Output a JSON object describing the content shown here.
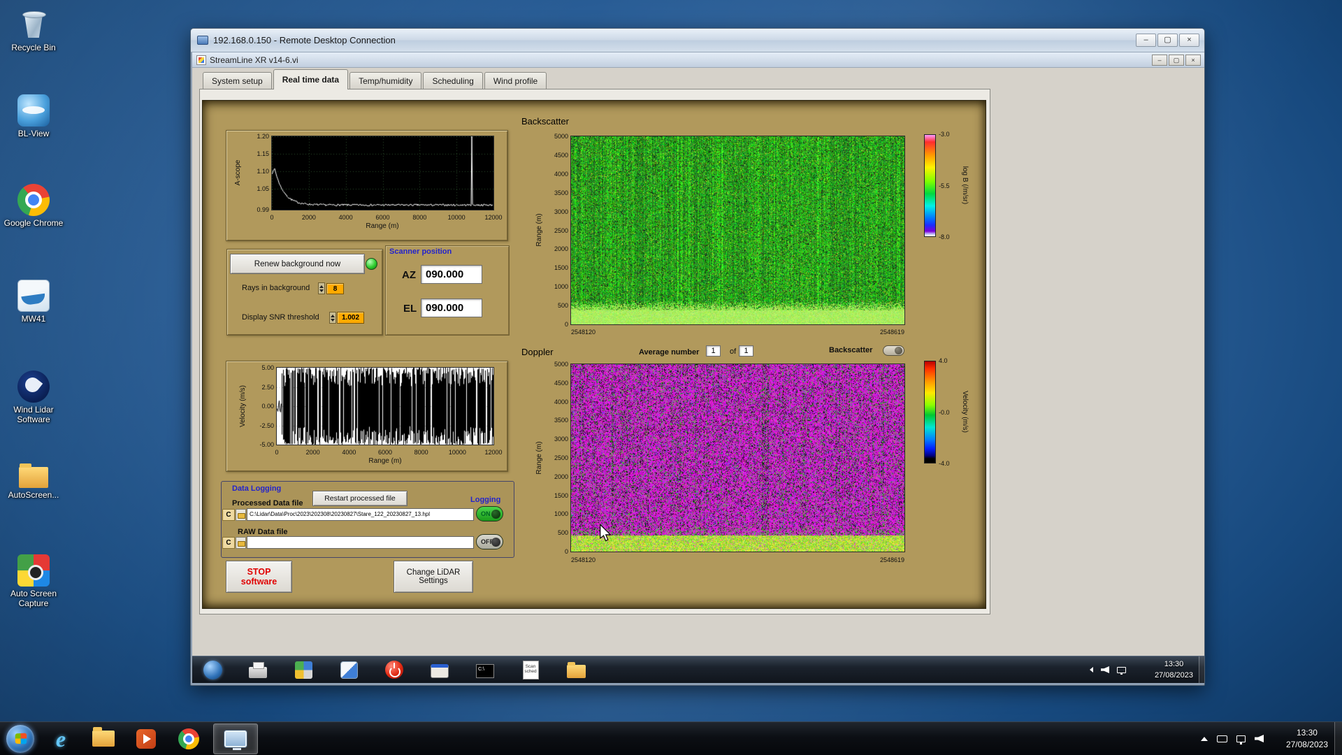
{
  "rdp": {
    "title": "192.168.0.150 - Remote Desktop Connection",
    "buttons": [
      {
        "name": "rdp-minimize-button",
        "glyph": "–"
      },
      {
        "name": "rdp-maximize-button",
        "glyph": "▢"
      },
      {
        "name": "rdp-close-button",
        "glyph": "×"
      }
    ]
  },
  "app": {
    "title": "StreamLine XR v14-6.vi",
    "buttons": [
      {
        "name": "app-minimize-button",
        "glyph": "–"
      },
      {
        "name": "app-restore-button",
        "glyph": "▢"
      },
      {
        "name": "app-close-button",
        "glyph": "×"
      }
    ],
    "tabs": [
      {
        "label": "System setup",
        "active": false
      },
      {
        "label": "Real time data",
        "active": true
      },
      {
        "label": "Temp/humidity",
        "active": false
      },
      {
        "label": "Scheduling",
        "active": false
      },
      {
        "label": "Wind profile",
        "active": false
      }
    ]
  },
  "panel": {
    "backscatter_title": "Backscatter",
    "doppler_title": "Doppler",
    "renew_button": "Renew background now",
    "rays_label": "Rays in background",
    "rays_value": "8",
    "snr_label": "Display SNR threshold",
    "snr_value": "1.002",
    "scanner": {
      "title": "Scanner position",
      "az_label": "AZ",
      "az_value": "090.000",
      "el_label": "EL",
      "el_value": "090.000"
    },
    "average": {
      "label": "Average number",
      "value": "1",
      "of_label": "of",
      "total": "1"
    },
    "backscatter_toggle_label": "Backscatter",
    "logging": {
      "title": "Data Logging",
      "processed_label": "Processed Data file",
      "restart_button": "Restart processed file",
      "logging_label": "Logging",
      "drive_label": "C",
      "processed_path": "C:\\Lidar\\Data\\Proc\\2023\\202308\\20230827\\Stare_122_20230827_13.hpl",
      "raw_label": "RAW Data file",
      "raw_path": "",
      "on_label": "ON",
      "off_label": "OFF"
    },
    "stop_button_line1": "STOP",
    "stop_button_line2": "software",
    "change_button_line1": "Change LiDAR",
    "change_button_line2": "Settings"
  },
  "chart_data": [
    {
      "id": "a_scope",
      "type": "line",
      "ylabel": "A-scope",
      "xlabel": "Range (m)",
      "xlim": [
        0,
        12000
      ],
      "ylim": [
        0.99,
        1.2
      ],
      "x_ticks": [
        0,
        2000,
        4000,
        6000,
        8000,
        10000,
        12000
      ],
      "y_ticks": [
        1.2,
        1.15,
        1.1,
        1.05,
        0.99
      ],
      "y_tick_labels": [
        "1.20",
        "1.15",
        "1.10",
        "1.05",
        "0.99"
      ],
      "grid": true,
      "line_color": "#ffffff",
      "background": "#000000",
      "series": [
        {
          "name": "a-scope trace",
          "x": [
            0,
            60,
            150,
            300,
            500,
            800,
            1200,
            1600,
            2000,
            3000,
            4000,
            5000,
            6000,
            7000,
            8000,
            9000,
            10000,
            10750,
            10820,
            10890,
            11500,
            12000
          ],
          "y": [
            1.093,
            1.102,
            1.108,
            1.062,
            1.035,
            1.018,
            1.009,
            1.006,
            1.005,
            1.004,
            1.004,
            1.003,
            1.004,
            1.003,
            1.004,
            1.003,
            1.004,
            1.004,
            1.2,
            1.004,
            1.003,
            1.003
          ]
        }
      ],
      "annotations": [
        "narrow full-height spike near 10800 m"
      ]
    },
    {
      "id": "backscatter",
      "type": "heatmap",
      "title": "Backscatter",
      "ylabel": "Range (m)",
      "ylim": [
        0,
        5000
      ],
      "y_ticks": [
        5000,
        4500,
        4000,
        3500,
        3000,
        2500,
        2000,
        1500,
        1000,
        500,
        0
      ],
      "x_tick_labels": [
        "2548120",
        "2548619"
      ],
      "colorbar": {
        "label": "log B (/m/sr)",
        "tick_labels": [
          "-3.0",
          "-5.5",
          "-8.0"
        ],
        "range": [
          -3.0,
          -8.0
        ]
      },
      "bands": [
        {
          "range_m": [
            0,
            450
          ],
          "value": "high backscatter (bright green, approx -5 log B)"
        },
        {
          "range_m": [
            450,
            5000
          ],
          "value": "uncorrelated green/black noise speckle"
        }
      ]
    },
    {
      "id": "velocity",
      "type": "line",
      "ylabel": "Velocity (m/s)",
      "xlabel": "Range (m)",
      "xlim": [
        0,
        12000
      ],
      "ylim": [
        -5,
        5
      ],
      "x_ticks": [
        0,
        2000,
        4000,
        6000,
        8000,
        10000,
        12000
      ],
      "y_ticks": [
        5.0,
        2.5,
        0.0,
        -2.5,
        -5.0
      ],
      "y_tick_labels": [
        "5.00",
        "2.50",
        "0.00",
        "-2.50",
        "-5.00"
      ],
      "line_color": "#000000",
      "background": "#ffffff",
      "description": "coherent velocities near 0 m/s below ~300 m; full-scale ±5 m/s noise at greater ranges"
    },
    {
      "id": "doppler",
      "type": "heatmap",
      "title": "Doppler",
      "ylabel": "Range (m)",
      "ylim": [
        0,
        5000
      ],
      "y_ticks": [
        5000,
        4500,
        4000,
        3500,
        3000,
        2500,
        2000,
        1500,
        1000,
        500,
        0
      ],
      "x_tick_labels": [
        "2548120",
        "2548619"
      ],
      "colorbar": {
        "label": "Velocity (m/s)",
        "tick_labels": [
          "4.0",
          "-0.0",
          "-4.0"
        ],
        "range": [
          4.0,
          -4.0
        ]
      },
      "bands": [
        {
          "range_m": [
            0,
            450
          ],
          "value": "coherent low velocities (green/yellow band)"
        },
        {
          "range_m": [
            450,
            5000
          ],
          "value": "random magenta/black velocity noise"
        }
      ]
    }
  ],
  "desktop": {
    "icons": [
      {
        "name": "recycle-bin-icon",
        "label": "Recycle Bin",
        "kind": "recycle"
      },
      {
        "name": "bl-view-icon",
        "label": "BL-View",
        "kind": "blview"
      },
      {
        "name": "google-chrome-icon",
        "label": "Google Chrome",
        "kind": "chrome"
      },
      {
        "name": "mw41-icon",
        "label": "MW41",
        "kind": "mw41"
      },
      {
        "name": "wind-lidar-software-icon",
        "label": "Wind Lidar Software",
        "kind": "windlidar"
      },
      {
        "name": "autoscreen-folder-icon",
        "label": "AutoScreen...",
        "kind": "folder"
      },
      {
        "name": "auto-screen-capture-icon",
        "label": "Auto Screen Capture",
        "kind": "capture"
      }
    ]
  },
  "remote_taskbar": {
    "time": "13:30",
    "date": "27/08/2023",
    "icons": [
      {
        "name": "remote-start-button",
        "kind": "orb"
      },
      {
        "name": "printer-icon",
        "kind": "printer"
      },
      {
        "name": "grid-app-icon",
        "kind": "grid"
      },
      {
        "name": "mw-app-icon",
        "kind": "mwapp"
      },
      {
        "name": "power-off-icon",
        "kind": "power"
      },
      {
        "name": "xp-window-icon",
        "kind": "xpwin"
      },
      {
        "name": "command-prompt-icon",
        "kind": "cmd",
        "glyph": "C:\\"
      },
      {
        "name": "scan-sched-icon",
        "kind": "note",
        "label": "Scan sched"
      },
      {
        "name": "remote-folder-icon",
        "kind": "folder"
      }
    ]
  },
  "host_taskbar": {
    "time": "13:30",
    "date": "27/08/2023",
    "buttons": [
      {
        "name": "start-button",
        "kind": "orb"
      },
      {
        "name": "internet-explorer-icon",
        "kind": "ie",
        "glyph": "e"
      },
      {
        "name": "windows-explorer-icon",
        "kind": "explorer"
      },
      {
        "name": "media-player-icon",
        "kind": "media"
      },
      {
        "name": "chrome-taskbar-icon",
        "kind": "chrome"
      },
      {
        "name": "rdp-taskbar-button",
        "kind": "rdp",
        "active": true
      }
    ],
    "tray": [
      {
        "name": "show-hidden-icons-button",
        "kind": "uparrow"
      },
      {
        "name": "input-indicator-icon",
        "kind": "kbd"
      },
      {
        "name": "network-icon",
        "kind": "net"
      },
      {
        "name": "volume-icon",
        "kind": "vol"
      }
    ]
  }
}
